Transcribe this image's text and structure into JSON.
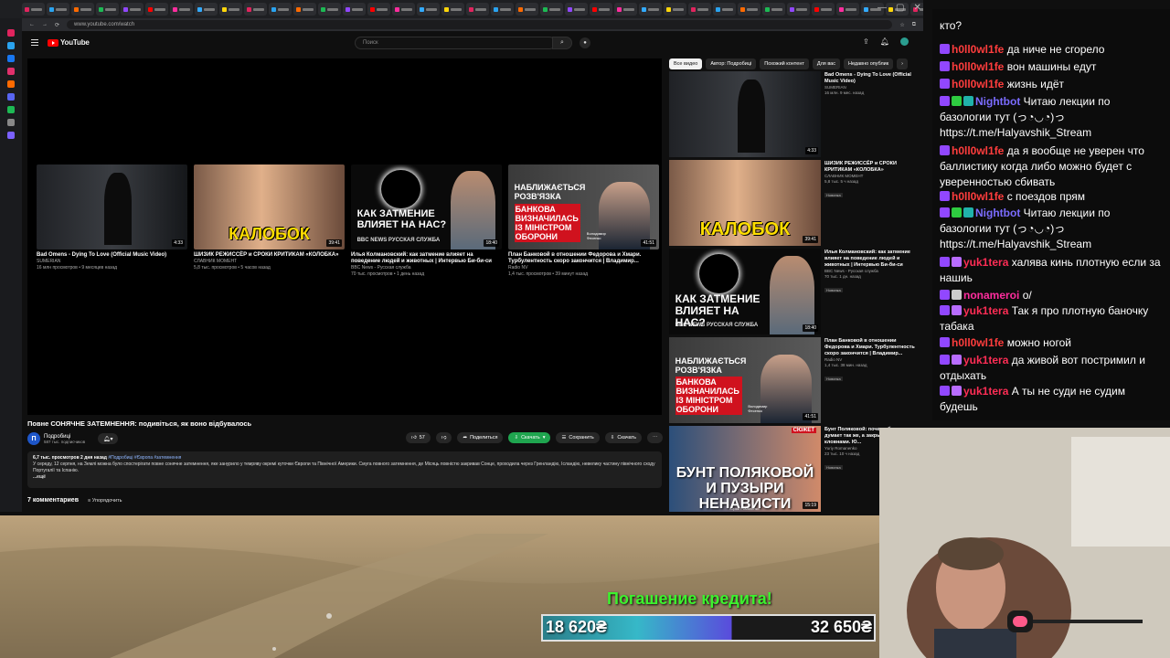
{
  "browser": {
    "url": "www.youtube.com/watch"
  },
  "youtube": {
    "logo_text": "YouTube",
    "search_placeholder": "Поиск",
    "end_cards": [
      {
        "title": "Bad Omens - Dying To Love (Official Music Video)",
        "channel": "SUMERIAN",
        "meta": "16 млн просмотров • 9 месяцев назад",
        "duration": "4:33"
      },
      {
        "title": "ШИЗИК РЕЖИССЁР и СРОКИ КРИТИКАМ «КОЛОБКА»",
        "channel": "СЛАВНИК МОМЕНТ",
        "meta": "5,8 тыс. просмотров • 5 часов назад",
        "duration": "39:41",
        "thumb_text": "КАЛОБОК"
      },
      {
        "title": "Илья Колмановский: как затмение влияет на поведение людей и животных | Интервью Би-би-си",
        "channel": "BBC News - Русская служба",
        "meta": "70 тыс. просмотров • 1 день назад",
        "duration": "18:40",
        "thumb_text": "КАК ЗАТМЕНИЕ ВЛИЯЕТ НА НАС?",
        "thumb_sub": "BBC NEWS РУССКАЯ СЛУЖБА"
      },
      {
        "title": "План Банковой в отношении Федорова и Хмари. Турбулентность скоро закончится | Владимир...",
        "channel": "Radio NV",
        "meta": "1,4 тыс. просмотров • 39 минут назад",
        "duration": "41:51",
        "thumb_text": "НАБЛИЖАЄТЬСЯ РОЗВ'ЯЗКА",
        "thumb_red": "БАНКОВА ВИЗНАЧИЛАСЬ ІЗ МІНІСТРОМ ОБОРОНИ",
        "thumb_name": "Володимир Фесенко"
      }
    ],
    "video_title": "Повне СОНЯЧНЕ ЗАТЕМНЕННЯ: подивіться, як воно відбувалось",
    "channel_name": "Подробиці",
    "channel_subs": "587 тыс. подписчиков",
    "actions": {
      "likes": "57",
      "share": "Поделиться",
      "download": "Скачать",
      "save": "Сохранить",
      "clip": "Скачать"
    },
    "description": {
      "views": "6,7 тыс. просмотров",
      "date": "2 дня назад",
      "tags": "#Подробиці #Європа #затемнення",
      "text": "У середу, 12 серпня, на Землі можна було спостерігати повне сонячне затемнення, яке занурило у темряву окремі куточки Європи та Північної Америки. Смуга повного затемнення, де Місяць повністю закривав Сонце, проходила через Гренландію, Ісландію, невелику частину північного сходу Португалії та Іспанію.",
      "more": "...ещё"
    },
    "comments_count": "7 комментариев",
    "sort_label": "Упорядочить",
    "chips": [
      "Все видео",
      "Автор: Подробиці",
      "Похожий контент",
      "Для вас",
      "Недавно опублик"
    ],
    "recs": [
      {
        "title": "Bad Omens - Dying To Love (Official Music Video)",
        "channel": "SUMERIAN",
        "meta": "16 млн. 9 мес. назад",
        "duration": "4:33"
      },
      {
        "title": "ШИЗИК РЕЖИССЁР и СРОКИ КРИТИКАМ «КОЛОБКА»",
        "channel": "СЛАВНИК МОМЕНТ",
        "meta": "5,8 тыс. 5 ч назад",
        "badge": "Новинка",
        "duration": "39:41",
        "thumb_text": "КАЛОБОК"
      },
      {
        "title": "Илья Колмановский: как затмение влияет на поведение людей и животных | Интервью Би-би-си",
        "channel": "BBC News - Русская служба",
        "meta": "70 тыс. 1 дн. назад",
        "badge": "Новинка",
        "duration": "18:40",
        "thumb_text": "КАК ЗАТМЕНИЕ ВЛИЯЕТ НА НАС?",
        "thumb_sub": "BBC NEWS РУССКАЯ СЛУЖБА"
      },
      {
        "title": "План Банковой в отношении Федорова и Хмари. Турбулентность скоро закончится | Владимир...",
        "channel": "Radio NV",
        "meta": "1,4 тыс. 38 мин. назад",
        "badge": "Новинка",
        "duration": "41:51",
        "thumb_text": "НАБЛИЖАЄТЬСЯ РОЗВ'ЯЗКА",
        "thumb_red": "БАНКОВА ВИЗНАЧИЛАСЬ ІЗ МІНІСТРОМ ОБОРОНИ",
        "thumb_name": "Володимир Фесенко"
      },
      {
        "title": "Бунт Поляковой: почему бизнес думает так же, а закрытыми кловнами. Ю...",
        "channel": "Yuriy Romanenko",
        "meta": "23 тыс. 10 ч назад",
        "badge": "Новинка",
        "duration": "15:19",
        "thumb_text": "БУНТ ПОЛЯКОВОЙ И ПУЗЫРИ НЕНАВИСТИ",
        "thumb_tag": "СЮЖЕТ",
        "thumb_name": "Юрий Романенко"
      }
    ]
  },
  "chat": {
    "lines": [
      {
        "user": "",
        "text": "кто?",
        "color": "#ffffff",
        "badges": []
      },
      {
        "user": "h0ll0wl1fe",
        "text": "да ниче не сгорело",
        "color": "#ff3d3d",
        "badges": [
          "#9147ff"
        ]
      },
      {
        "user": "h0ll0wl1fe",
        "text": "вон машины едут",
        "color": "#ff3d3d",
        "badges": [
          "#9147ff"
        ]
      },
      {
        "user": "h0ll0wl1fe",
        "text": "жизнь идёт",
        "color": "#ff3d3d",
        "badges": [
          "#9147ff"
        ]
      },
      {
        "user": "Nightbot",
        "text": "Читаю лекции по базологии тут (っ◔◡◔)っ https://t.me/Halyavshik_Stream",
        "color": "#7b6cff",
        "badges": [
          "#9147ff",
          "#2ecc40",
          "#20b2aa"
        ]
      },
      {
        "user": "h0ll0wl1fe",
        "text": "да я вообще не уверен что баллистику когда либо можно будет с уверенностью сбивать",
        "color": "#ff3d3d",
        "badges": [
          "#9147ff"
        ]
      },
      {
        "user": "h0ll0wl1fe",
        "text": "с поездов прям",
        "color": "#ff3d3d",
        "badges": [
          "#9147ff"
        ]
      },
      {
        "user": "Nightbot",
        "text": "Читаю лекции по базологии тут (っ◔◡◔)っ https://t.me/Halyavshik_Stream",
        "color": "#7b6cff",
        "badges": [
          "#9147ff",
          "#2ecc40",
          "#20b2aa"
        ]
      },
      {
        "user": "yuk1tera",
        "text": "халява кинь плотную если за нашиь",
        "color": "#ff2d55",
        "badges": [
          "#9147ff",
          "#b86cff"
        ]
      },
      {
        "user": "nonameroi",
        "text": "о/",
        "color": "#ff2d9e",
        "badges": [
          "#9147ff",
          "#cccccc"
        ]
      },
      {
        "user": "yuk1tera",
        "text": "Так я про плотную баночку табака",
        "color": "#ff2d55",
        "badges": [
          "#9147ff",
          "#b86cff"
        ]
      },
      {
        "user": "h0ll0wl1fe",
        "text": "можно ногой",
        "color": "#ff3d3d",
        "badges": [
          "#9147ff"
        ]
      },
      {
        "user": "yuk1tera",
        "text": "да живой вот постримил и отдыхать",
        "color": "#ff2d55",
        "badges": [
          "#9147ff",
          "#b86cff"
        ]
      },
      {
        "user": "yuk1tera",
        "text": "А ты не суди не судим будешь",
        "color": "#ff2d55",
        "badges": [
          "#9147ff",
          "#b86cff"
        ]
      }
    ]
  },
  "overlay": {
    "credit_title": "Погашение кредита!",
    "credit_current": "18 620₴",
    "credit_goal": "32 650₴",
    "credit_progress": 0.57
  }
}
